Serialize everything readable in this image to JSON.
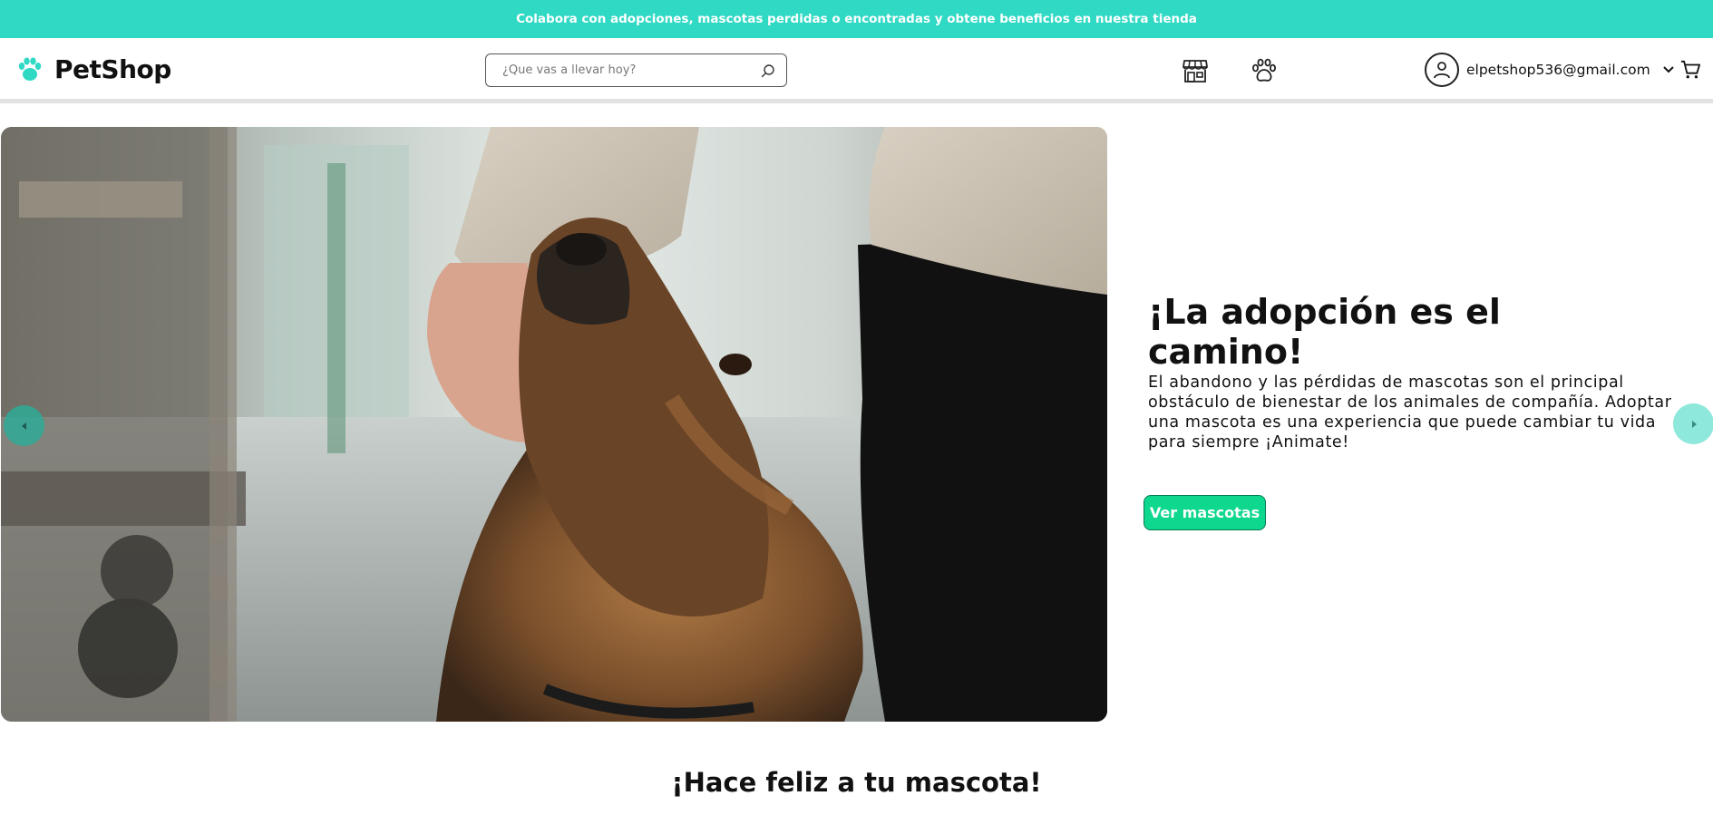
{
  "promo": {
    "text": "Colabora con adopciones, mascotas perdidas o encontradas y obtene beneficios en nuestra tienda"
  },
  "header": {
    "brand": "PetShop",
    "search": {
      "placeholder": "¿Que vas a llevar hoy?",
      "value": ""
    },
    "icons": [
      "store-icon",
      "paw-icon",
      "user-icon",
      "chevron-down-icon",
      "cart-icon"
    ],
    "user_email": "elpetshop536@gmail.com"
  },
  "hero": {
    "title": "¡La adopción es el camino!",
    "description": "El abandono y las pérdidas de mascotas son el principal obstáculo de bienestar de los animales de compañía. Adoptar una mascota es una experiencia que puede cambiar tu vida para siempre ¡Animate!",
    "cta_label": "Ver mascotas"
  },
  "section": {
    "title": "¡Hace feliz a tu mascota!"
  },
  "colors": {
    "accent": "#2fd9c4",
    "cta": "#0ed88e",
    "text": "#111111"
  }
}
